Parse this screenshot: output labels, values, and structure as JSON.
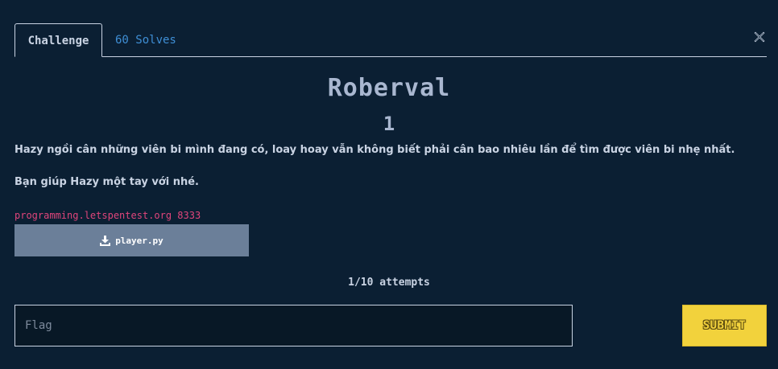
{
  "tabs": {
    "challenge": "Challenge",
    "solves": "60 Solves"
  },
  "challenge": {
    "name": "Roberval",
    "points": "1",
    "description_1": "Hazy ngồi cân những viên bi mình đang có, loay hoay vẫn không biết phải cân bao nhiêu lần để tìm được viên bi nhẹ nhất.",
    "description_2": "Bạn giúp Hazy một tay với nhé.",
    "connection": "programming.letspentest.org 8333",
    "file_label": "player.py"
  },
  "submission": {
    "attempts": "1/10 attempts",
    "flag_placeholder": "Flag",
    "flag_value": "",
    "submit_label": "SUBMIT"
  },
  "icons": {
    "close": "close-icon",
    "download": "download-icon"
  },
  "colors": {
    "background": "#0b1f33",
    "accent_link": "#3f8fd6",
    "connection_text": "#e0457b",
    "file_button": "#6b7f99",
    "submit_button": "#f2d23c"
  }
}
